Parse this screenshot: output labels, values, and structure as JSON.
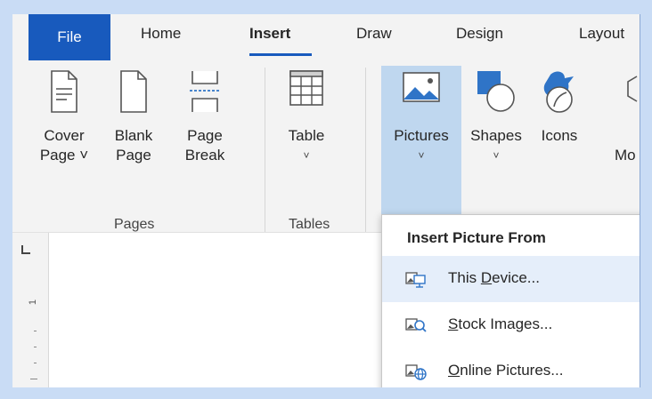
{
  "tabs": {
    "file": "File",
    "home": "Home",
    "insert": "Insert",
    "draw": "Draw",
    "design": "Design",
    "layout": "Layout"
  },
  "ribbon": {
    "cover_page": {
      "line1": "Cover",
      "line2": "Page ˅"
    },
    "blank_page": {
      "line1": "Blank",
      "line2": "Page"
    },
    "page_break": {
      "line1": "Page",
      "line2": "Break"
    },
    "table": {
      "line1": "Table",
      "line2": "˅"
    },
    "pictures": {
      "line1": "Pictures",
      "line2": "˅"
    },
    "shapes": {
      "line1": "Shapes",
      "line2": "˅"
    },
    "icons": {
      "line1": "Icons"
    },
    "models_partial": "Mo",
    "groups": {
      "pages": "Pages",
      "tables": "Tables"
    }
  },
  "ruler": {
    "number": "1"
  },
  "dropdown": {
    "header": "Insert Picture From",
    "items": [
      {
        "prefix": "This ",
        "key": "D",
        "rest": "evice...",
        "icon": "this-device-icon"
      },
      {
        "prefix": "",
        "key": "S",
        "rest": "tock Images...",
        "icon": "stock-images-icon"
      },
      {
        "prefix": "",
        "key": "O",
        "rest": "nline Pictures...",
        "icon": "online-pictures-icon"
      }
    ]
  },
  "colors": {
    "accent": "#185abd",
    "highlight": "#bfd7ef",
    "hover": "#e5eefa",
    "background": "#c9dcf5"
  }
}
